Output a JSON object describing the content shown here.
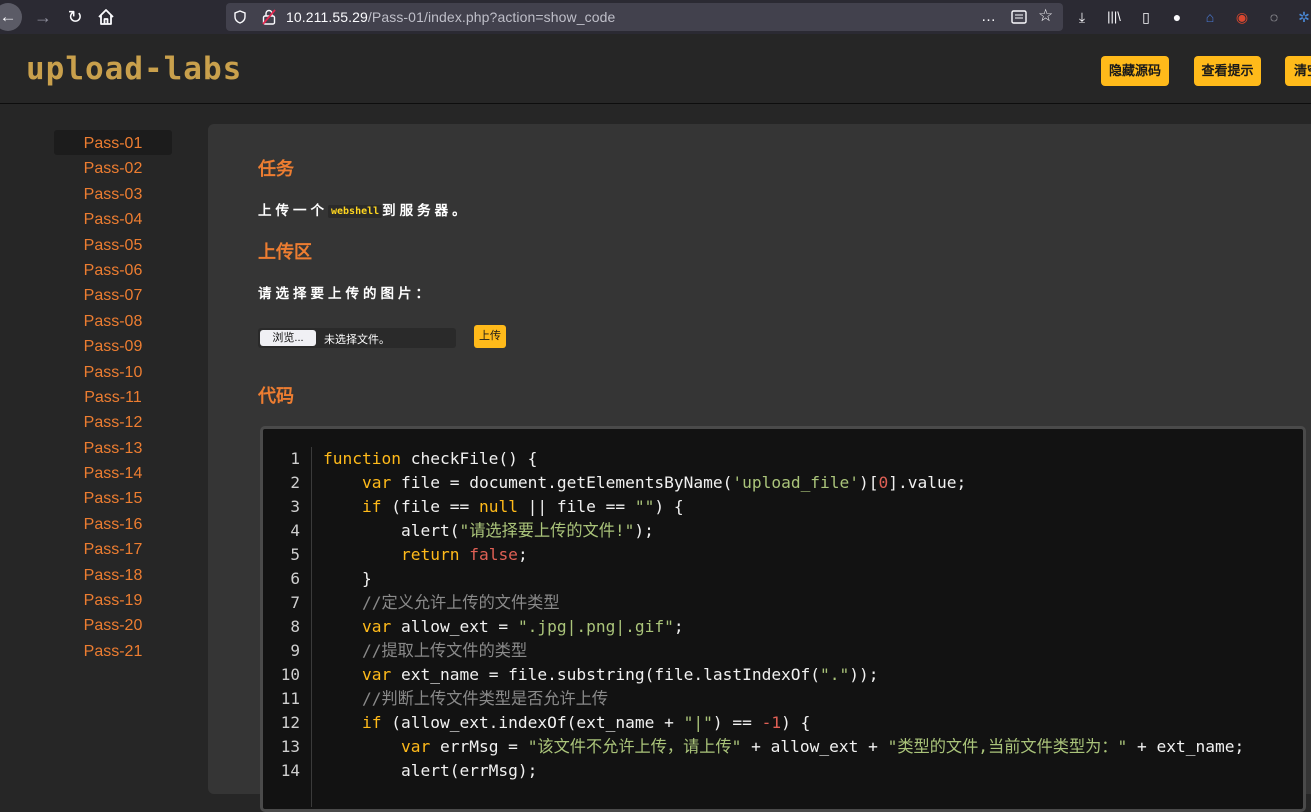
{
  "browser": {
    "url_host": "10.211.55.29",
    "url_path": "/Pass-01/index.php?action=show_code",
    "more_icon": "…",
    "colors": {
      "chrome_bg": "#2b2a33",
      "urlbar_bg": "#42414d"
    }
  },
  "site": {
    "logo_text": "upload-labs",
    "buttons": {
      "hide_source": "隐藏源码",
      "view_hint": "查看提示",
      "clear": "清空"
    }
  },
  "sidebar": {
    "items": [
      "Pass-01",
      "Pass-02",
      "Pass-03",
      "Pass-04",
      "Pass-05",
      "Pass-06",
      "Pass-07",
      "Pass-08",
      "Pass-09",
      "Pass-10",
      "Pass-11",
      "Pass-12",
      "Pass-13",
      "Pass-14",
      "Pass-15",
      "Pass-16",
      "Pass-17",
      "Pass-18",
      "Pass-19",
      "Pass-20",
      "Pass-21"
    ],
    "active_index": 0
  },
  "task": {
    "heading": "任务",
    "text_before": "上传一个",
    "code_word": "webshell",
    "text_after": "到服务器。"
  },
  "upload": {
    "heading": "上传区",
    "prompt": "请选择要上传的图片：",
    "browse_label": "浏览...",
    "no_file_label": "未选择文件。",
    "submit_label": "上传"
  },
  "code": {
    "heading": "代码",
    "line_numbers": [
      "1",
      "2",
      "3",
      "4",
      "5",
      "6",
      "7",
      "8",
      "9",
      "10",
      "11",
      "12",
      "13",
      "14"
    ]
  },
  "accent_colors": {
    "orange": "#ed7d31",
    "yellow": "#ffba1a"
  }
}
